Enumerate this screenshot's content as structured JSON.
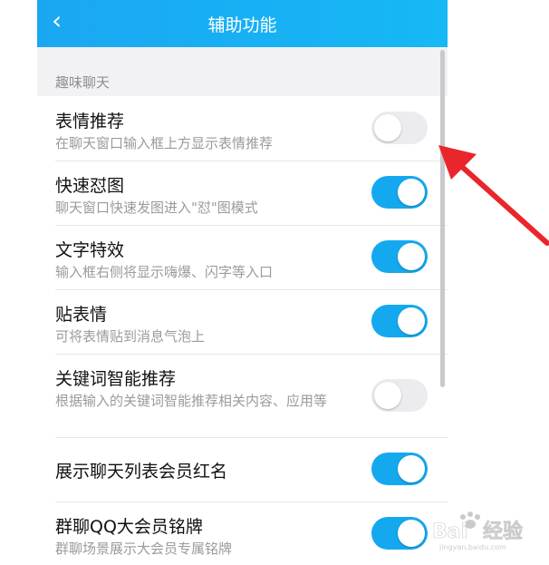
{
  "header": {
    "title": "辅助功能",
    "back_icon": "chevron-left-icon"
  },
  "section": {
    "label": "趣味聊天"
  },
  "settings": [
    {
      "title": "表情推荐",
      "subtitle": "在聊天窗口输入框上方显示表情推荐",
      "enabled": false
    },
    {
      "title": "快速怼图",
      "subtitle": "聊天窗口快速发图进入\"怼\"图模式",
      "enabled": true
    },
    {
      "title": "文字特效",
      "subtitle": "输入框右侧将显示嗨爆、闪字等入口",
      "enabled": true
    },
    {
      "title": "贴表情",
      "subtitle": "可将表情贴到消息气泡上",
      "enabled": true
    },
    {
      "title": "关键词智能推荐",
      "subtitle": "根据输入的关键词智能推荐相关内容、应用等",
      "enabled": false
    },
    {
      "title": "展示聊天列表会员红名",
      "subtitle": "",
      "enabled": true
    },
    {
      "title": "群聊QQ大会员铭牌",
      "subtitle": "群聊场景展示大会员专属铭牌",
      "enabled": true
    }
  ],
  "colors": {
    "header": "#1aa7f2",
    "toggle_on": "#14a9ef",
    "toggle_off": "#ebebf0",
    "arrow": "#e8262b"
  },
  "watermark": {
    "brand": "Baidu经验",
    "url": "jingyan.baidu.com"
  }
}
